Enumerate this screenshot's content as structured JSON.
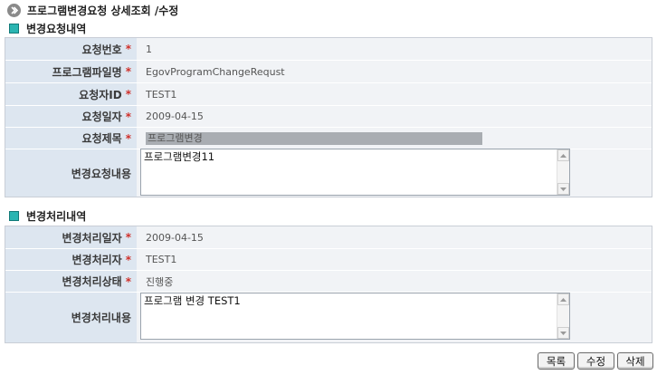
{
  "page": {
    "title": "프로그램변경요청 상세조회 /수정"
  },
  "request_section": {
    "title": "변경요청내역",
    "rows": [
      {
        "label": "요청번호",
        "required": "*",
        "value": "1"
      },
      {
        "label": "프로그램파일명",
        "required": "*",
        "value": "EgovProgramChangeRequst"
      },
      {
        "label": "요청자ID",
        "required": "*",
        "value": "TEST1"
      },
      {
        "label": "요청일자",
        "required": "*",
        "value": "2009-04-15"
      },
      {
        "label": "요청제목",
        "required": "*",
        "value": "프로그램변경"
      },
      {
        "label": "변경요청내용",
        "value": "프로그램변경11"
      }
    ]
  },
  "process_section": {
    "title": "변경처리내역",
    "rows": [
      {
        "label": "변경처리일자",
        "required": "*",
        "value": "2009-04-15"
      },
      {
        "label": "변경처리자",
        "required": "*",
        "value": "TEST1"
      },
      {
        "label": "변경처리상태",
        "required": "*",
        "value": "진행중"
      },
      {
        "label": "변경처리내용",
        "value": "프로그램 변경 TEST1"
      }
    ]
  },
  "buttons": {
    "list": "목록",
    "edit": "수정",
    "delete": "삭제"
  },
  "colors": {
    "label_bg": "#dde6f0",
    "value_bg": "#f1f3f6",
    "required": "#d0302a",
    "section_icon": "#2bb5b2"
  },
  "icons": {
    "title": "chevron-right-circle-icon",
    "section": "square-bullet-icon"
  }
}
